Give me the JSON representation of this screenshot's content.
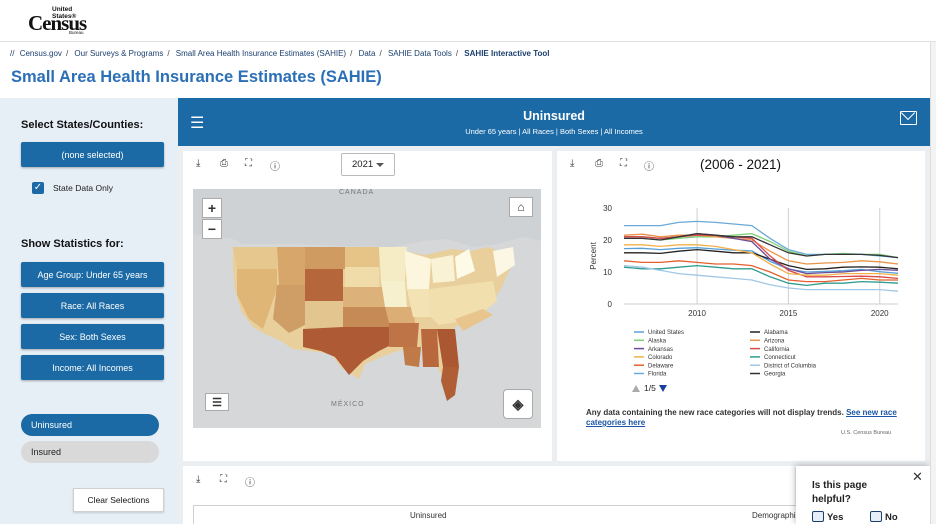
{
  "logo": {
    "line1": "United States®",
    "line2": "Census",
    "line3": "Bureau"
  },
  "breadcrumbs": [
    "//",
    "Census.gov",
    "Our Surveys & Programs",
    "Small Area Health Insurance Estimates (SAHIE)",
    "Data",
    "SAHIE Data Tools",
    "SAHIE Interactive Tool"
  ],
  "page_title": "Small Area Health Insurance Estimates (SAHIE)",
  "sidebar": {
    "select_heading": "Select States/Counties:",
    "selection_button": "(none selected)",
    "state_only_label": "State Data Only",
    "state_only_checked": true,
    "stats_heading": "Show Statistics for:",
    "stat_buttons": [
      "Age Group: Under 65 years",
      "Race: All Races",
      "Sex: Both Sexes",
      "Income: All Incomes"
    ],
    "measure_options": [
      {
        "label": "Uninsured",
        "selected": true
      },
      {
        "label": "Insured",
        "selected": false
      }
    ],
    "clear_button": "Clear Selections"
  },
  "banner": {
    "title": "Uninsured",
    "subtitle": "Under 65 years | All Races | Both Sexes | All Incomes"
  },
  "map_panel": {
    "year": "2021",
    "labels": {
      "canada": "CANADA",
      "mexico": "MÉXICO"
    },
    "zoom_in": "+",
    "zoom_out": "−"
  },
  "trend_panel": {
    "title": "(2006 - 2021)",
    "pager": "1/5",
    "note": "Any data containing the new race categories will not display trends.",
    "note_link": "See new race categories here",
    "source": "U.S. Census Bureau"
  },
  "chart_data": {
    "type": "line",
    "title": "(2006 - 2021)",
    "xlabel": "",
    "ylabel": "Percent",
    "xlim": [
      2006,
      2021
    ],
    "ylim": [
      0,
      30
    ],
    "xticks": [
      2010,
      2015,
      2020
    ],
    "yticks": [
      0,
      10,
      20,
      30
    ],
    "grid": "vertical",
    "legend_position": "bottom",
    "x": [
      2006,
      2007,
      2008,
      2009,
      2010,
      2011,
      2012,
      2013,
      2014,
      2015,
      2016,
      2017,
      2018,
      2019,
      2020,
      2021
    ],
    "series": [
      {
        "name": "United States",
        "color": "#5aa0d8",
        "values": [
          17.3,
          17.4,
          17.0,
          17.4,
          17.6,
          17.2,
          16.8,
          16.6,
          13.3,
          10.9,
          10.0,
          10.2,
          10.4,
          10.8,
          10.1,
          9.6
        ]
      },
      {
        "name": "Alabama",
        "color": "#222222",
        "values": [
          16.0,
          16.0,
          15.8,
          16.5,
          17.0,
          16.5,
          16.0,
          16.0,
          14.0,
          12.0,
          10.8,
          11.0,
          11.5,
          11.6,
          11.5,
          11.0
        ]
      },
      {
        "name": "Alaska",
        "color": "#7ccf75",
        "values": [
          20.5,
          20.5,
          20.0,
          20.5,
          21.0,
          21.0,
          21.5,
          22.0,
          19.5,
          16.5,
          15.0,
          15.5,
          15.8,
          15.5,
          15.5,
          14.5
        ]
      },
      {
        "name": "Arizona",
        "color": "#e8944a",
        "values": [
          21.5,
          21.8,
          21.0,
          21.5,
          21.5,
          21.0,
          20.5,
          20.0,
          16.5,
          13.5,
          12.5,
          12.8,
          13.0,
          13.5,
          13.2,
          12.5
        ]
      },
      {
        "name": "Arkansas",
        "color": "#6b4c9a",
        "values": [
          21.0,
          21.0,
          20.5,
          21.0,
          22.0,
          21.5,
          20.5,
          19.5,
          14.0,
          11.0,
          9.5,
          9.8,
          10.0,
          10.5,
          10.8,
          10.5
        ]
      },
      {
        "name": "California",
        "color": "#d94a4a",
        "values": [
          21.0,
          21.0,
          20.5,
          21.0,
          21.5,
          21.5,
          21.0,
          20.5,
          15.0,
          10.5,
          8.5,
          8.5,
          8.6,
          8.7,
          8.5,
          8.0
        ]
      },
      {
        "name": "Colorado",
        "color": "#f2b14a",
        "values": [
          18.5,
          18.5,
          18.0,
          18.5,
          18.5,
          18.0,
          17.0,
          16.0,
          12.5,
          9.5,
          9.0,
          9.0,
          9.5,
          9.5,
          9.5,
          9.0
        ]
      },
      {
        "name": "Connecticut",
        "color": "#2e9c8e",
        "values": [
          11.5,
          11.0,
          11.0,
          11.5,
          12.0,
          11.5,
          11.0,
          11.0,
          8.5,
          6.5,
          5.8,
          6.5,
          6.5,
          7.0,
          6.8,
          6.5
        ]
      },
      {
        "name": "Delaware",
        "color": "#e35f2c",
        "values": [
          13.5,
          13.0,
          13.0,
          13.5,
          13.0,
          12.5,
          12.5,
          12.0,
          10.0,
          7.5,
          7.0,
          7.0,
          7.5,
          8.0,
          7.5,
          7.5
        ]
      },
      {
        "name": "District of Columbia",
        "color": "#a0c8e8",
        "values": [
          12.0,
          11.5,
          10.5,
          9.5,
          9.0,
          8.5,
          8.0,
          7.5,
          6.0,
          5.0,
          4.5,
          4.5,
          4.5,
          4.5,
          4.5,
          4.0
        ]
      },
      {
        "name": "Florida",
        "color": "#6aaad8",
        "values": [
          24.5,
          24.5,
          24.5,
          25.5,
          25.8,
          25.5,
          25.0,
          24.5,
          20.5,
          17.0,
          15.5,
          15.5,
          15.5,
          15.5,
          15.0,
          14.5
        ]
      },
      {
        "name": "Georgia",
        "color": "#333333",
        "values": [
          20.5,
          20.5,
          20.0,
          21.0,
          22.0,
          21.5,
          21.0,
          21.0,
          18.5,
          16.0,
          15.0,
          15.5,
          15.5,
          15.5,
          15.2,
          14.5
        ]
      }
    ]
  },
  "table_panel": {
    "col_uninsured": "Uninsured",
    "col_demographic": "Demographi"
  },
  "feedback": {
    "question": "Is this page helpful?",
    "yes": "Yes",
    "no": "No"
  }
}
